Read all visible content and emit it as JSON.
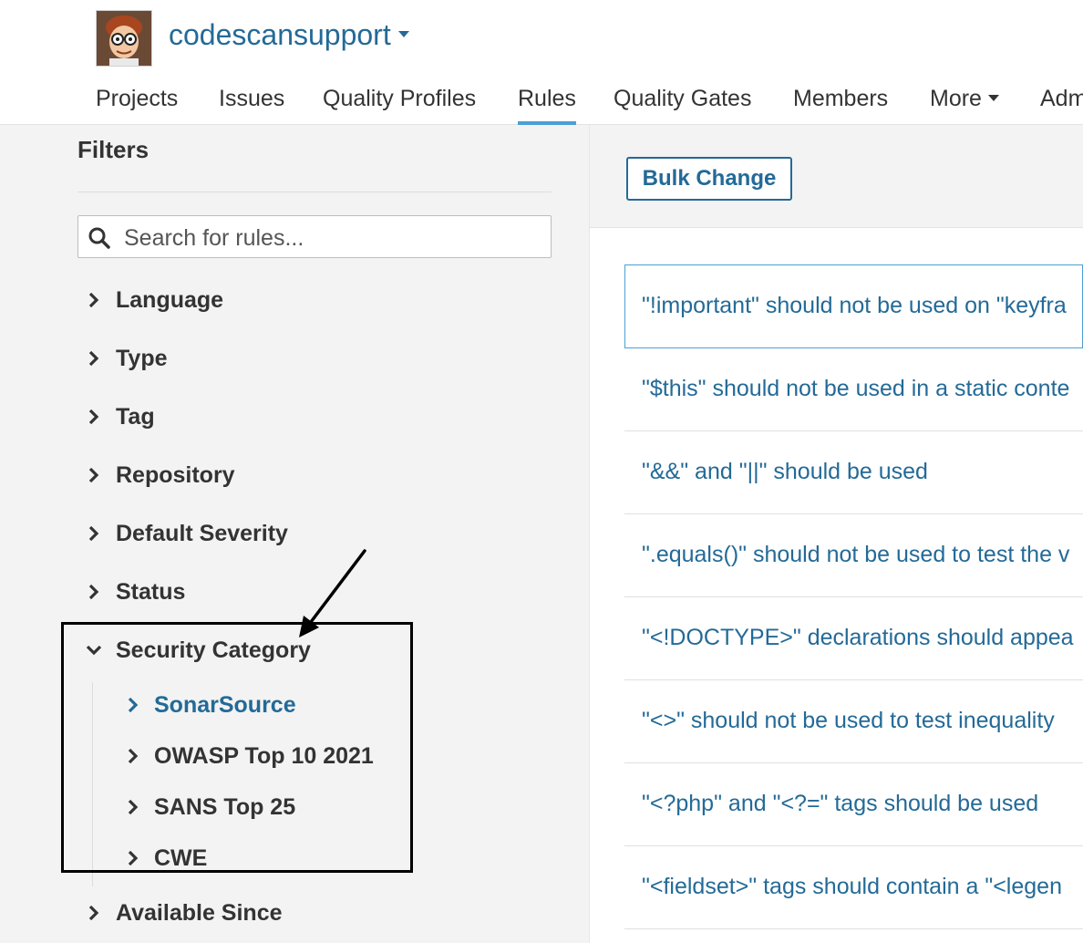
{
  "header": {
    "org_name": "codescansupport",
    "nav": [
      {
        "label": "Projects"
      },
      {
        "label": "Issues"
      },
      {
        "label": "Quality Profiles"
      },
      {
        "label": "Rules",
        "active": true
      },
      {
        "label": "Quality Gates"
      },
      {
        "label": "Members"
      },
      {
        "label": "More"
      },
      {
        "label": "Adm"
      }
    ],
    "active_tab_color": "#4b9fd5"
  },
  "sidebar": {
    "title": "Filters",
    "search_placeholder": "Search for rules...",
    "facets": [
      {
        "label": "Language",
        "expanded": false
      },
      {
        "label": "Type",
        "expanded": false
      },
      {
        "label": "Tag",
        "expanded": false
      },
      {
        "label": "Repository",
        "expanded": false
      },
      {
        "label": "Default Severity",
        "expanded": false
      },
      {
        "label": "Status",
        "expanded": false
      },
      {
        "label": "Security Category",
        "expanded": true
      },
      {
        "label": "Available Since",
        "expanded": false
      }
    ],
    "security_subitems": [
      {
        "label": "SonarSource",
        "active": true
      },
      {
        "label": "OWASP Top 10 2021"
      },
      {
        "label": "SANS Top 25"
      },
      {
        "label": "CWE"
      }
    ]
  },
  "main": {
    "bulk_change_label": "Bulk Change",
    "rules": [
      {
        "text": "\"!important\" should not be used on \"keyfra",
        "selected": true
      },
      {
        "text": "\"$this\" should not be used in a static conte"
      },
      {
        "text": "\"&&\" and \"||\" should be used"
      },
      {
        "text": "\".equals()\" should not be used to test the v"
      },
      {
        "text": "\"<!DOCTYPE>\" declarations should appea"
      },
      {
        "text": "\"<>\" should not be used to test inequality"
      },
      {
        "text": "\"<?php\" and \"<?=\" tags should be used"
      },
      {
        "text": "\"<fieldset>\" tags should contain a \"<legen"
      }
    ]
  },
  "colors": {
    "link_blue": "#236a97",
    "sidebar_bg": "#f3f3f3",
    "annotation": "#000000"
  }
}
